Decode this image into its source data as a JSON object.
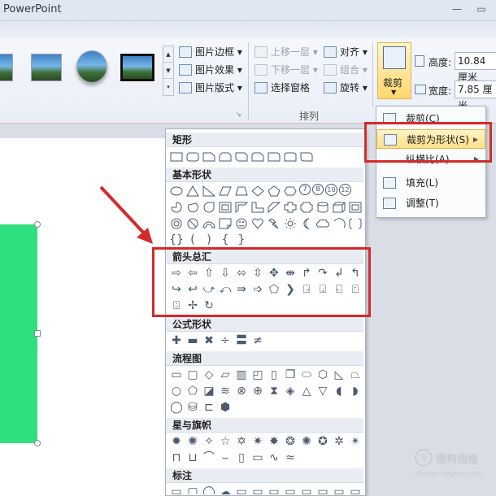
{
  "window": {
    "title": "PowerPoint",
    "minimize": "—",
    "restore": "▭"
  },
  "ribbon": {
    "picture_styles": {
      "border_label": "图片边框",
      "effects_label": "图片效果",
      "layout_label": "图片版式"
    },
    "arrange": {
      "bring_forward": "上移一层",
      "send_backward": "下移一层",
      "selection_pane": "选择窗格",
      "align": "对齐",
      "group": "组合",
      "rotate": "旋转",
      "group_label": "排列"
    },
    "size": {
      "crop_label": "裁剪",
      "height_label": "高度:",
      "height_value": "10.84 厘米",
      "width_label": "宽度:",
      "width_value": "7.85 厘米"
    }
  },
  "crop_menu": {
    "items": [
      {
        "label": "裁剪(C)",
        "highlighted": false,
        "submenu": false
      },
      {
        "label": "裁剪为形状(S)",
        "highlighted": true,
        "submenu": true
      },
      {
        "label": "纵横比(A)",
        "highlighted": false,
        "submenu": true
      },
      {
        "label": "填充(L)",
        "highlighted": false,
        "submenu": false
      },
      {
        "label": "调整(T)",
        "highlighted": false,
        "submenu": false
      }
    ]
  },
  "shape_menu": {
    "categories": [
      {
        "name": "矩形"
      },
      {
        "name": "基本形状"
      },
      {
        "name": "箭头总汇"
      },
      {
        "name": "公式形状"
      },
      {
        "name": "流程图"
      },
      {
        "name": "星与旗帜"
      },
      {
        "name": "标注"
      }
    ],
    "basic_number_shapes": [
      "7",
      "8",
      "10",
      "12"
    ]
  },
  "colors": {
    "shape_fill": "#2fe07e",
    "annotation_red": "#d42a2a"
  },
  "watermark": {
    "brand": "搜狗指南",
    "url": "zhinan.sogou.com"
  }
}
